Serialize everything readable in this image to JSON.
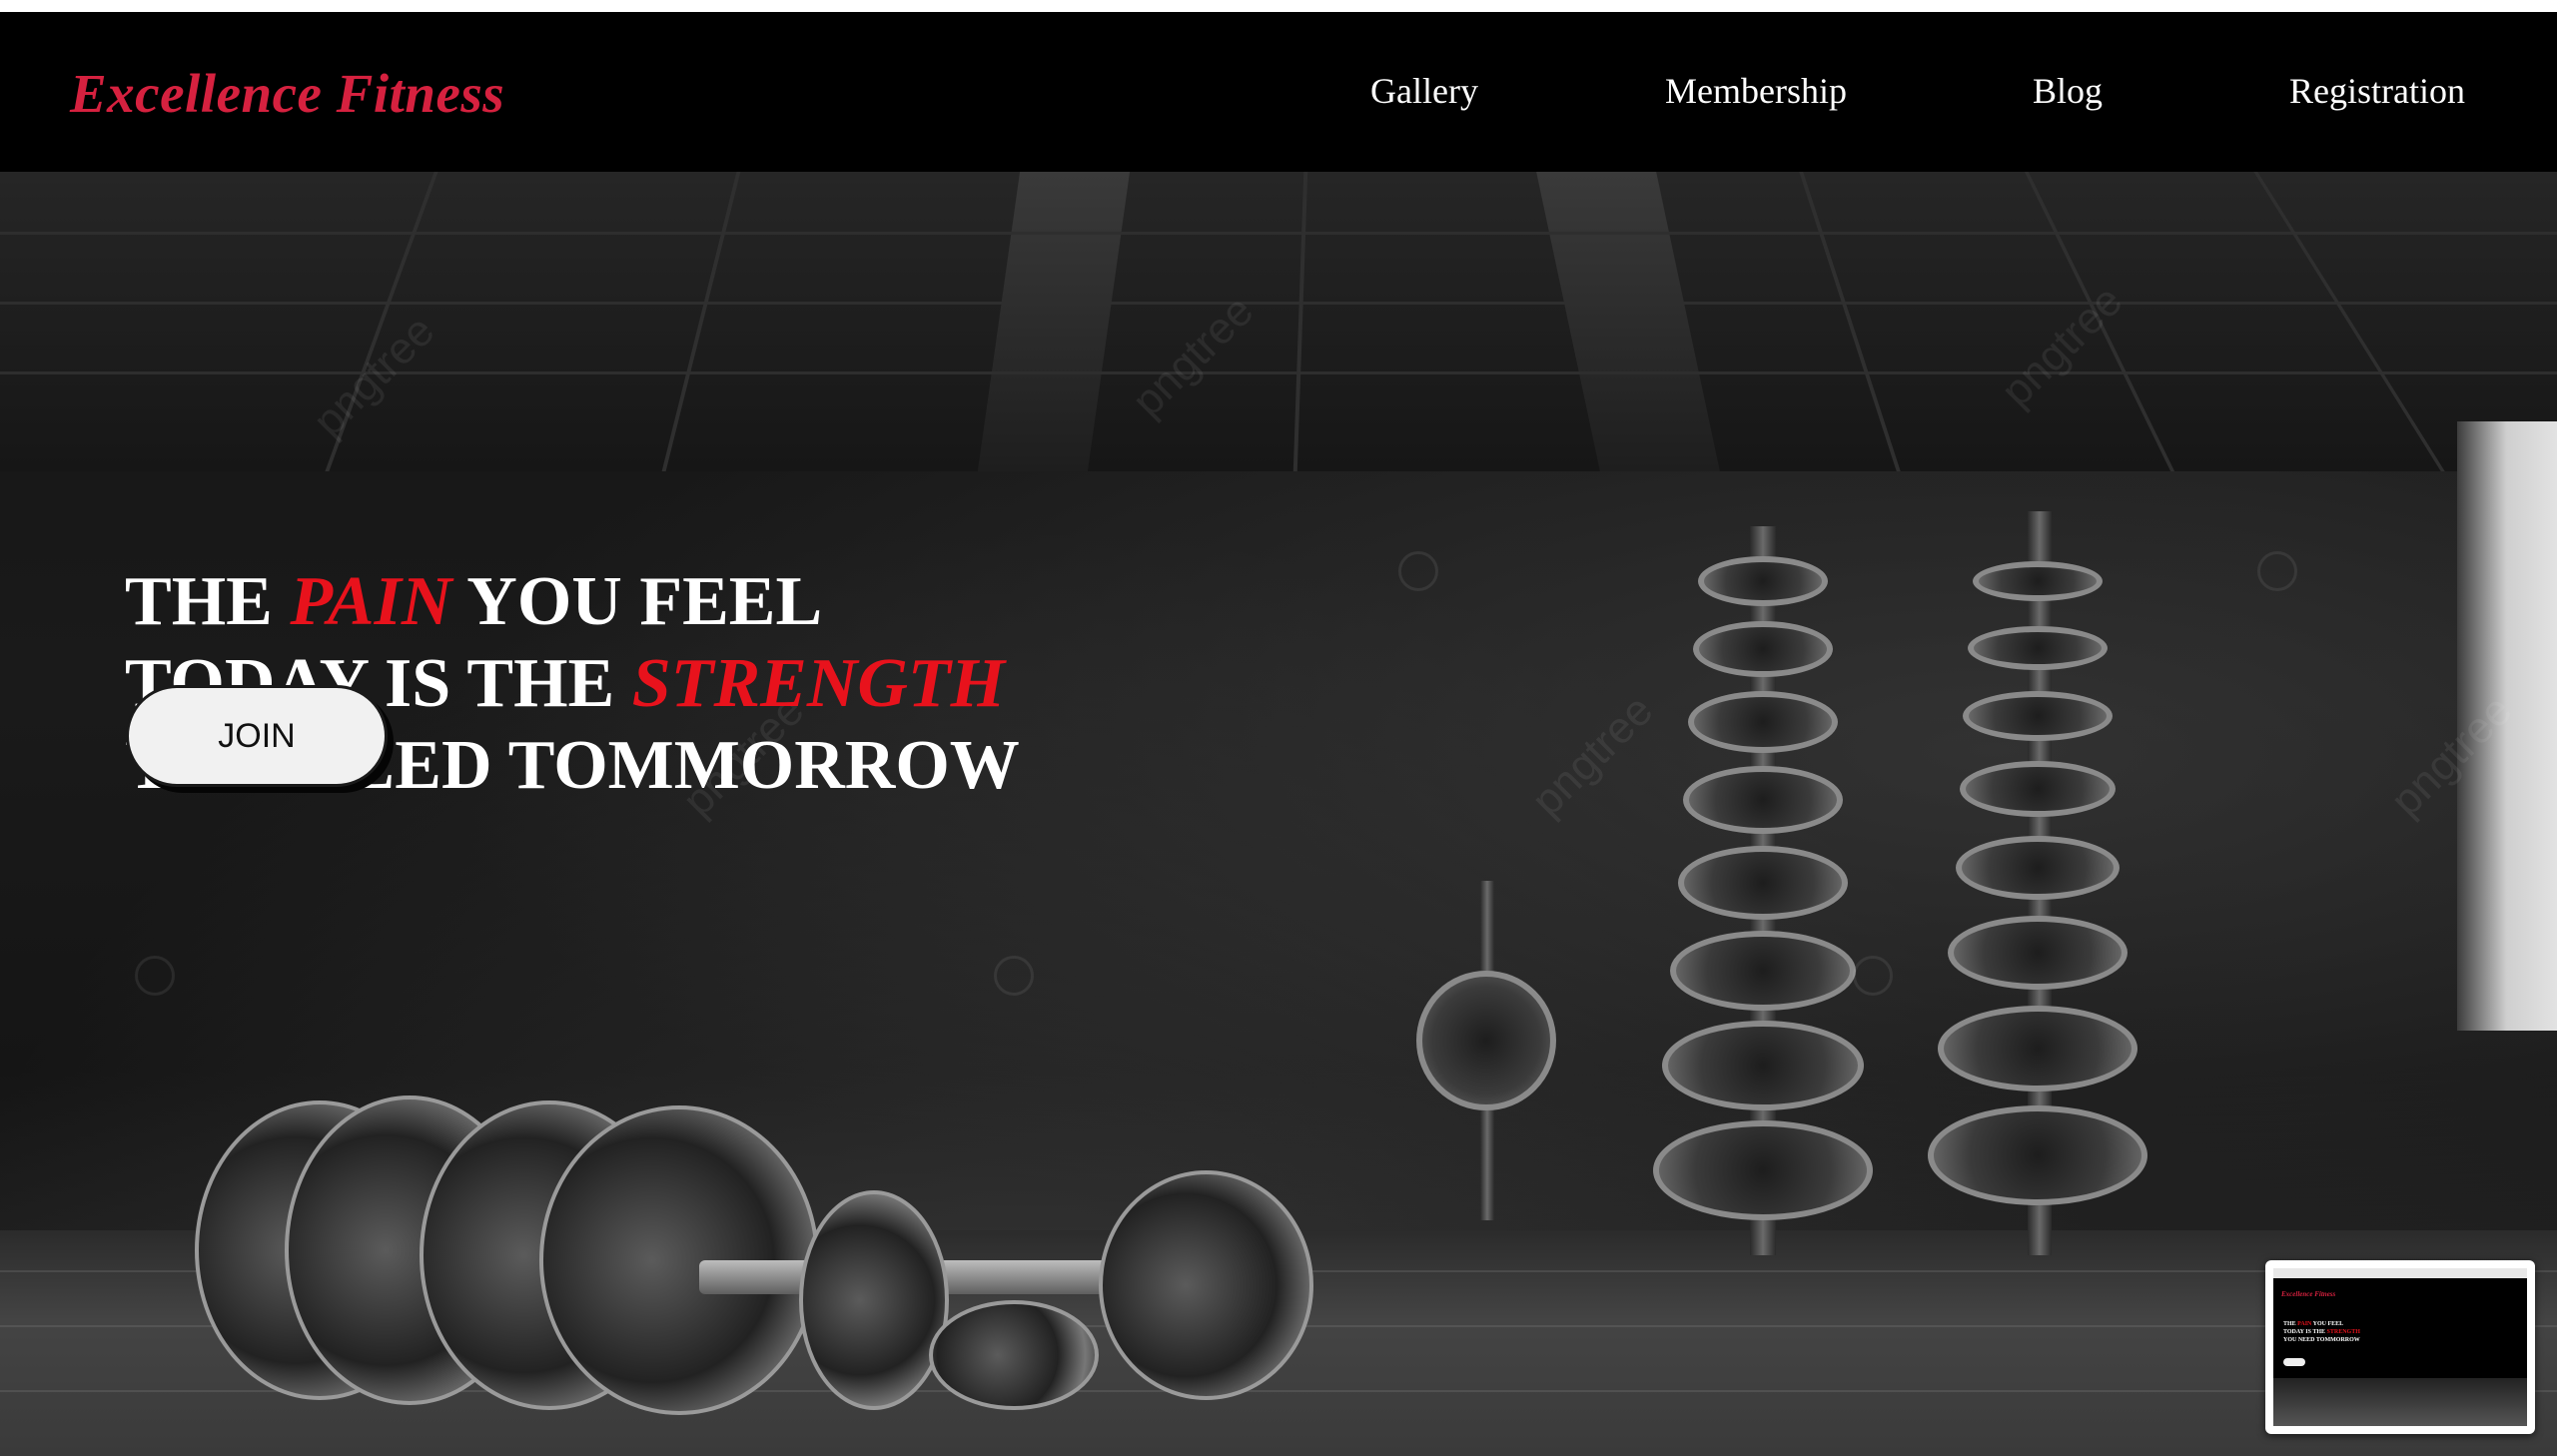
{
  "colors": {
    "brand": "#d6213f",
    "accent": "#e8121c",
    "nav_background": "#000000",
    "text": "#ffffff"
  },
  "header": {
    "brand": "Excellence Fitness",
    "nav": {
      "gallery": "Gallery",
      "membership": "Membership",
      "blog": "Blog",
      "registration": "Registration"
    }
  },
  "hero": {
    "line1_a": "THE ",
    "line1_accent": "PAIN",
    "line1_b": " YOU FEEL",
    "line2_a": "TODAY IS THE ",
    "line2_accent": "STRENGTH",
    "line3": "YOU NEED TOMMORROW",
    "join_label": "JOIN"
  },
  "background": {
    "watermark_text": "pngtree"
  },
  "thumbnail": {
    "brand": "Excellence Fitness",
    "line1_a": "THE ",
    "line1_accent": "PAIN",
    "line1_b": " YOU FEEL",
    "line2_a": "TODAY IS THE ",
    "line2_accent": "STRENGTH",
    "line3": "YOU NEED TOMMORROW"
  }
}
